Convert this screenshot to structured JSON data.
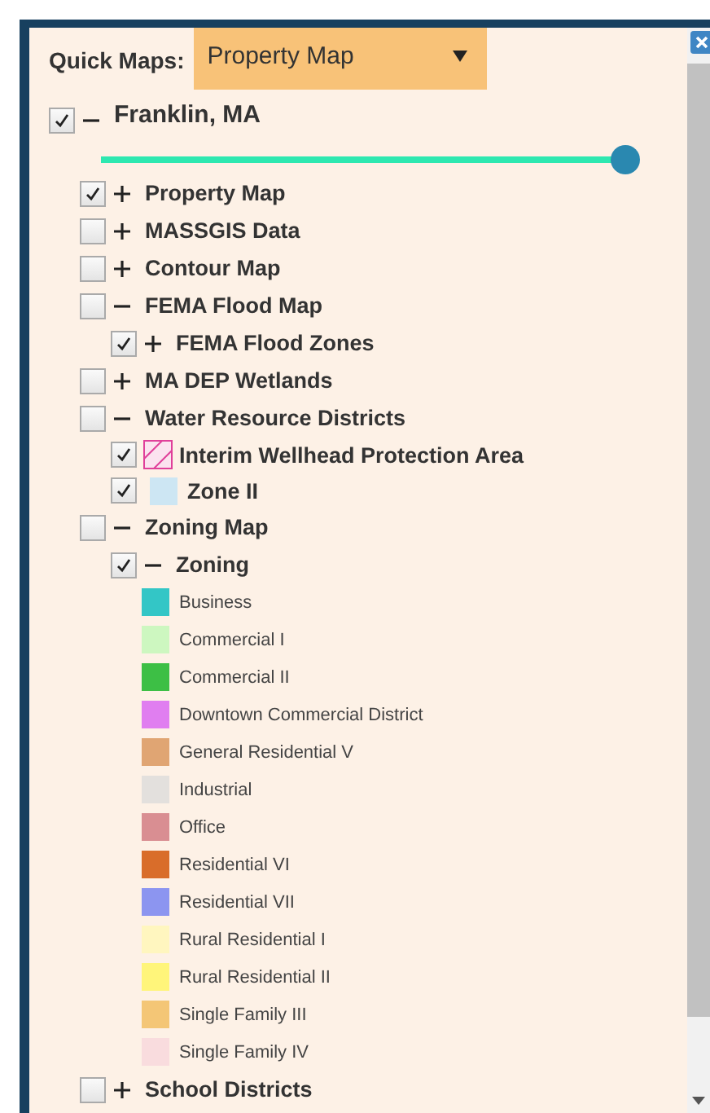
{
  "quick_maps": {
    "label": "Quick Maps:",
    "value": "Property Map"
  },
  "tree": [
    {
      "kind": "group",
      "label": "Franklin, MA",
      "checked": true,
      "expanded": true,
      "slider": {
        "level": 1
      },
      "children": [
        {
          "kind": "group",
          "label": "Property Map",
          "checked": true,
          "expanded": false
        },
        {
          "kind": "group",
          "label": "MASSGIS Data",
          "checked": false,
          "expanded": false
        },
        {
          "kind": "group",
          "label": "Contour Map",
          "checked": false,
          "expanded": false
        },
        {
          "kind": "group",
          "label": "FEMA Flood Map",
          "checked": false,
          "expanded": true,
          "children": [
            {
              "kind": "group",
              "label": "FEMA Flood Zones",
              "checked": true,
              "expanded": false
            }
          ]
        },
        {
          "kind": "group",
          "label": "MA DEP Wetlands",
          "checked": false,
          "expanded": false
        },
        {
          "kind": "group",
          "label": "Water Resource Districts",
          "checked": false,
          "expanded": true,
          "children": [
            {
              "kind": "hatched",
              "label": "Interim Wellhead Protection Area",
              "checked": true,
              "color": "#e0409a"
            },
            {
              "kind": "swatch",
              "label": "Zone II",
              "checked": true,
              "color": "#cde6f3"
            }
          ]
        },
        {
          "kind": "group",
          "label": "Zoning Map",
          "checked": false,
          "expanded": true,
          "children": [
            {
              "kind": "group",
              "label": "Zoning",
              "checked": true,
              "expanded": true,
              "children": [
                {
                  "kind": "legend",
                  "label": "Business",
                  "color": "#33c6c6"
                },
                {
                  "kind": "legend",
                  "label": "Commercial I",
                  "color": "#cdf7c0"
                },
                {
                  "kind": "legend",
                  "label": "Commercial II",
                  "color": "#3dbf45"
                },
                {
                  "kind": "legend",
                  "label": "Downtown Commercial District",
                  "color": "#e07ef0"
                },
                {
                  "kind": "legend",
                  "label": "General Residential V",
                  "color": "#e0a573"
                },
                {
                  "kind": "legend",
                  "label": "Industrial",
                  "color": "#e3e0dd"
                },
                {
                  "kind": "legend",
                  "label": "Office",
                  "color": "#d98e92"
                },
                {
                  "kind": "legend",
                  "label": "Residential VI",
                  "color": "#d96d2a"
                },
                {
                  "kind": "legend",
                  "label": "Residential VII",
                  "color": "#8c95f0"
                },
                {
                  "kind": "legend",
                  "label": "Rural Residential I",
                  "color": "#fff6bf"
                },
                {
                  "kind": "legend",
                  "label": "Rural Residential II",
                  "color": "#fff57a"
                },
                {
                  "kind": "legend",
                  "label": "Single Family III",
                  "color": "#f4c676"
                },
                {
                  "kind": "legend",
                  "label": "Single Family IV",
                  "color": "#f9dcde"
                }
              ]
            }
          ]
        },
        {
          "kind": "group",
          "label": "School Districts",
          "checked": false,
          "expanded": false
        }
      ]
    }
  ]
}
